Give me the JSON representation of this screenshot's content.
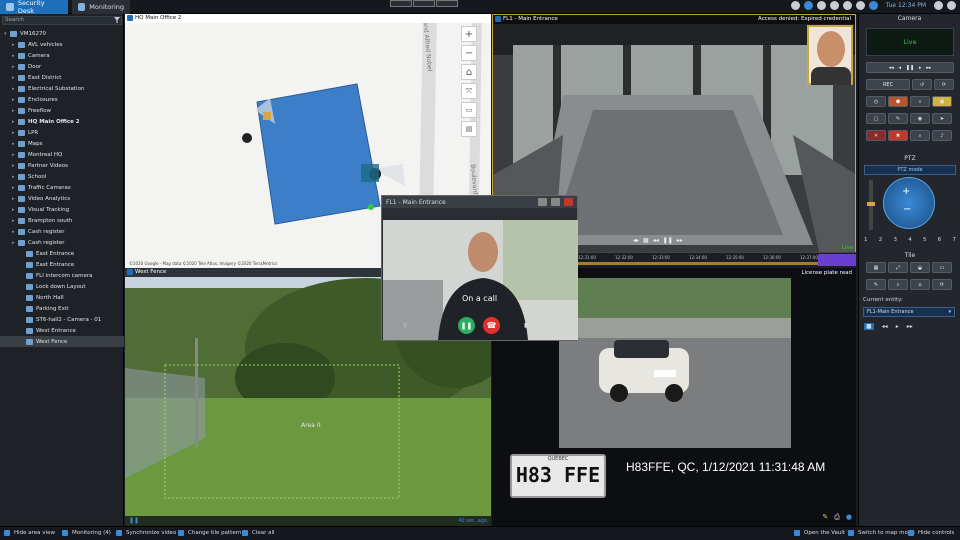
{
  "topbar": {
    "tabs": [
      {
        "label": "Security Desk",
        "active": true
      },
      {
        "label": "Monitoring",
        "active": false
      }
    ],
    "clock": "Tue 12:34 PM"
  },
  "sidebar": {
    "search_placeholder": "Search",
    "items": [
      {
        "label": "VM16270",
        "indent": 0,
        "expand": "▾"
      },
      {
        "label": "AVL vehicles",
        "indent": 1,
        "expand": "▸"
      },
      {
        "label": "Camera",
        "indent": 1,
        "expand": "▸"
      },
      {
        "label": "Door",
        "indent": 1,
        "expand": "▸"
      },
      {
        "label": "East District",
        "indent": 1,
        "expand": "▸"
      },
      {
        "label": "Electrical Substation",
        "indent": 1,
        "expand": "▸"
      },
      {
        "label": "Enclosures",
        "indent": 1,
        "expand": "▸"
      },
      {
        "label": "Freeflow",
        "indent": 1,
        "expand": "▸"
      },
      {
        "label": "HQ Main Office 2",
        "indent": 1,
        "expand": "▸",
        "bold": true
      },
      {
        "label": "LPR",
        "indent": 1,
        "expand": "▸"
      },
      {
        "label": "Maps",
        "indent": 1,
        "expand": "▸"
      },
      {
        "label": "Montreal HQ",
        "indent": 1,
        "expand": "▸"
      },
      {
        "label": "Partner Videos",
        "indent": 1,
        "expand": "▸"
      },
      {
        "label": "School",
        "indent": 1,
        "expand": "▸"
      },
      {
        "label": "Traffic Cameras",
        "indent": 1,
        "expand": "▸"
      },
      {
        "label": "Video Analytics",
        "indent": 1,
        "expand": "▸"
      },
      {
        "label": "Visual Tracking",
        "indent": 1,
        "expand": "▸"
      },
      {
        "label": "Brampton south",
        "indent": 1,
        "expand": "▸"
      },
      {
        "label": "Cash register",
        "indent": 1,
        "expand": "▸"
      },
      {
        "label": "Cash register",
        "indent": 1,
        "expand": "▸"
      },
      {
        "label": "East Entrance",
        "indent": 2,
        "expand": ""
      },
      {
        "label": "East Entrance",
        "indent": 2,
        "expand": ""
      },
      {
        "label": "FLI intercom camera",
        "indent": 2,
        "expand": ""
      },
      {
        "label": "Lock down Layout",
        "indent": 2,
        "expand": ""
      },
      {
        "label": "North Hall",
        "indent": 2,
        "expand": ""
      },
      {
        "label": "Parking Exit",
        "indent": 2,
        "expand": ""
      },
      {
        "label": "ST6-hall2 - Camera - 01",
        "indent": 2,
        "expand": ""
      },
      {
        "label": "West Entrance",
        "indent": 2,
        "expand": ""
      },
      {
        "label": "West Fence",
        "indent": 2,
        "expand": "",
        "selected": true
      }
    ]
  },
  "tiles": {
    "map": {
      "num": "1",
      "title": "HQ Main Office 2",
      "copyright": "©2020 Google - Map data ©2020 Tele Atlas, Imagery ©2020 TerraMetrics",
      "street1": "Grand Alfred Nobel",
      "street2": "Boulevard"
    },
    "entrance": {
      "num": "2",
      "title": "FL1 - Main Entrance",
      "alert": "Access denied: Expired credential",
      "live": "Live"
    },
    "fence": {
      "num": "3",
      "title": "West Fence",
      "area": "Area 0",
      "ago": "40 sec. ago"
    },
    "lpr": {
      "title": "License plate read",
      "plate": "H83 FFE",
      "province": "QUÉBEC",
      "read": "H83FFE, QC, 1/12/2021 11:31:48 AM"
    }
  },
  "timeline_ticks": [
    "12:31:00",
    "12:32:00",
    "12:33:00",
    "12:34:00",
    "12:35:00",
    "12:36:00",
    "12:37:00"
  ],
  "call": {
    "title": "FL1 - Main Entrance",
    "status": "On a call"
  },
  "right_panel": {
    "camera_header": "Camera",
    "live": "Live",
    "rec": "REC",
    "ptz_header": "PTZ",
    "ptz_mode": "PTZ mode",
    "presets": [
      "1",
      "2",
      "3",
      "4",
      "5",
      "6",
      "7"
    ],
    "tile_header": "Tile",
    "current_entity_label": "Current entity:",
    "current_entity_value": "FL1-Main Entrance"
  },
  "bottombar": {
    "items": [
      "Hide area view",
      "Monitoring (4)",
      "Synchronize video",
      "Change tile pattern",
      "Clear all"
    ],
    "right_items": [
      "Open the Vault",
      "Switch to map mode",
      "Hide controls"
    ]
  },
  "colors": {
    "accent": "#1d6fb8",
    "building": "#3d7ec9",
    "live": "#2ecc40",
    "alert_frame": "#c8a83a"
  }
}
